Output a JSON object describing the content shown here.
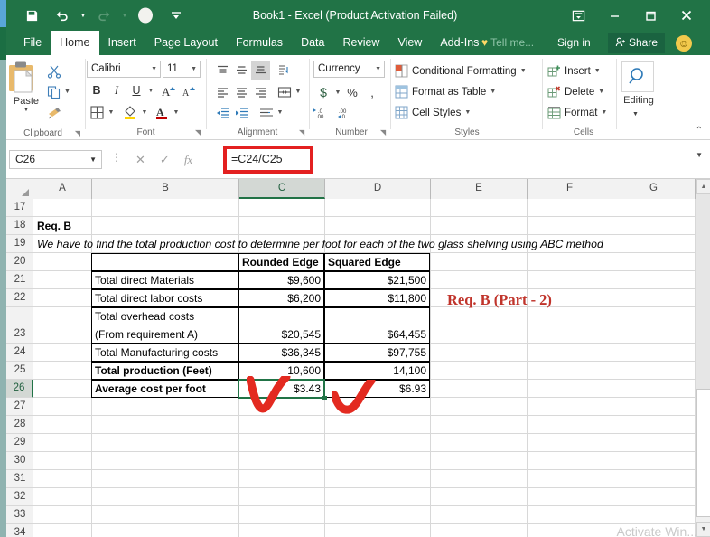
{
  "window": {
    "title": "Book1 - Excel (Product Activation Failed)",
    "quick_access": [
      "save-icon",
      "undo-icon",
      "redo-icon",
      "circle-icon",
      "customize-qat-icon"
    ],
    "controls": [
      "ribbon-display-options",
      "minimize",
      "maximize",
      "close"
    ]
  },
  "ribbon": {
    "tabs": [
      {
        "label": "File",
        "active": false
      },
      {
        "label": "Home",
        "active": true
      },
      {
        "label": "Insert",
        "active": false
      },
      {
        "label": "Page Layout",
        "active": false
      },
      {
        "label": "Formulas",
        "active": false
      },
      {
        "label": "Data",
        "active": false
      },
      {
        "label": "Review",
        "active": false
      },
      {
        "label": "View",
        "active": false
      },
      {
        "label": "Add-Ins",
        "active": false
      }
    ],
    "tell_me": "Tell me...",
    "sign_in": "Sign in",
    "share": "Share",
    "groups": {
      "clipboard": {
        "label": "Clipboard",
        "paste": "Paste"
      },
      "font": {
        "label": "Font",
        "font_name": "Calibri",
        "font_size": "11"
      },
      "alignment": {
        "label": "Alignment"
      },
      "number": {
        "label": "Number",
        "format": "Currency"
      },
      "styles": {
        "label": "Styles",
        "items": [
          "Conditional Formatting",
          "Format as Table",
          "Cell Styles"
        ]
      },
      "cells": {
        "label": "Cells",
        "items": [
          "Insert",
          "Delete",
          "Format"
        ]
      },
      "editing": {
        "label": "Editing"
      }
    }
  },
  "formula_bar": {
    "name_box": "C26",
    "formula": "=C24/C25",
    "cancel_icon": "cancel-icon",
    "enter_icon": "enter-icon",
    "function_icon": "insert-function-icon",
    "highlight_color": "#e32020"
  },
  "grid": {
    "columns": [
      {
        "label": "A",
        "selected": false
      },
      {
        "label": "B",
        "selected": false
      },
      {
        "label": "C",
        "selected": true
      },
      {
        "label": "D",
        "selected": false
      },
      {
        "label": "E",
        "selected": false
      },
      {
        "label": "F",
        "selected": false
      },
      {
        "label": "G",
        "selected": false
      }
    ],
    "rows": [
      "17",
      "18",
      "19",
      "20",
      "21",
      "22",
      "23",
      "24",
      "25",
      "26",
      "27",
      "28",
      "29",
      "30",
      "31",
      "32",
      "33",
      "34"
    ],
    "selected_row": "26",
    "selected_cell": "C26",
    "cells": {
      "a18": "Req. B",
      "a19": "We have to find the total production cost to determine per foot for each of the two glass shelving using ABC method",
      "c20": "Rounded Edge",
      "d20": "Squared Edge",
      "b21": "Total direct Materials",
      "c21": "$9,600",
      "d21": "$21,500",
      "b22": "Total direct labor costs",
      "c22": "$6,200",
      "d22": "$11,800",
      "b23_line1": "Total overhead costs",
      "b23_line2": "(From requirement A)",
      "c23": "$20,545",
      "d23": "$64,455",
      "b24": "Total Manufacturing costs",
      "c24": "$36,345",
      "d24": "$97,755",
      "b25": "Total production (Feet)",
      "c25": "10,600",
      "d25": "14,100",
      "b26": "Average cost per foot",
      "c26": "$3.43",
      "d26": "$6.93"
    },
    "annotation": {
      "text": "Req. B (Part - 2)",
      "color": "#c0342b"
    },
    "watermark": "Activate Win..."
  },
  "colors": {
    "excel_green": "#217346",
    "tab_green": "#217346",
    "selection_green": "#217346",
    "annotation_red": "#c0342b",
    "highlight_red": "#e32020"
  }
}
